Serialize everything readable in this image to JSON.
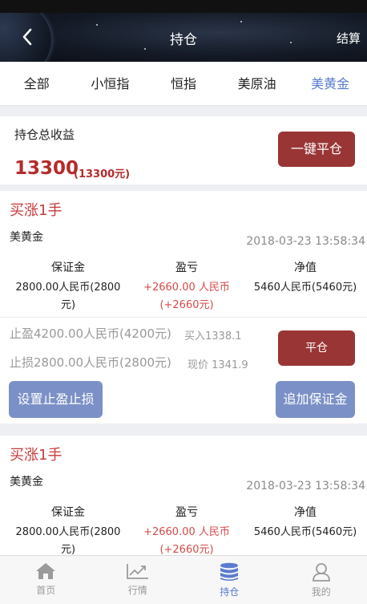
{
  "nav": {
    "title": "持仓",
    "settle": "结算"
  },
  "tabs": [
    "全部",
    "小恒指",
    "恒指",
    "美原油",
    "美黄金"
  ],
  "summary": {
    "label": "持仓总收益",
    "amount": "13300",
    "amount_sub": "(13300元)",
    "close_all": "一键平仓"
  },
  "positions": [
    {
      "direction": "买涨1手",
      "product": "美黄金",
      "time": "2018-03-23 13:58:34",
      "margin_label": "保证金",
      "margin_value_l1": "2800.00人民币(2800",
      "margin_value_l2": "元)",
      "pnl_label": "盈亏",
      "pnl_value_l1": "+2660.00 人民币",
      "pnl_value_l2": "(+2660元)",
      "net_label": "净值",
      "net_value": "5460人民币(5460元)",
      "take_profit": "止盈4200.00人民币(4200元)",
      "buy_price": "买入1338.1",
      "stop_loss": "止损2800.00人民币(2800元)",
      "current_price": "现价 1341.9",
      "close_label": "平仓",
      "set_sltp": "设置止盈止损",
      "add_margin": "追加保证金"
    },
    {
      "direction": "买涨1手",
      "product": "美黄金",
      "time": "2018-03-23 13:58:34",
      "margin_label": "保证金",
      "margin_value_l1": "2800.00人民币(2800",
      "margin_value_l2": "元)",
      "pnl_label": "盈亏",
      "pnl_value_l1": "+2660.00 人民币",
      "pnl_value_l2": "(+2660元)",
      "net_label": "净值",
      "net_value": "5460人民币(5460元)"
    }
  ],
  "tabbar": [
    {
      "label": "首页",
      "icon": "home-icon"
    },
    {
      "label": "行情",
      "icon": "chart-icon"
    },
    {
      "label": "持仓",
      "icon": "database-icon"
    },
    {
      "label": "我的",
      "icon": "user-icon"
    }
  ],
  "colors": {
    "accent_blue": "#5b7bd0",
    "red": "#9a3535",
    "profit": "#d64a4a"
  }
}
